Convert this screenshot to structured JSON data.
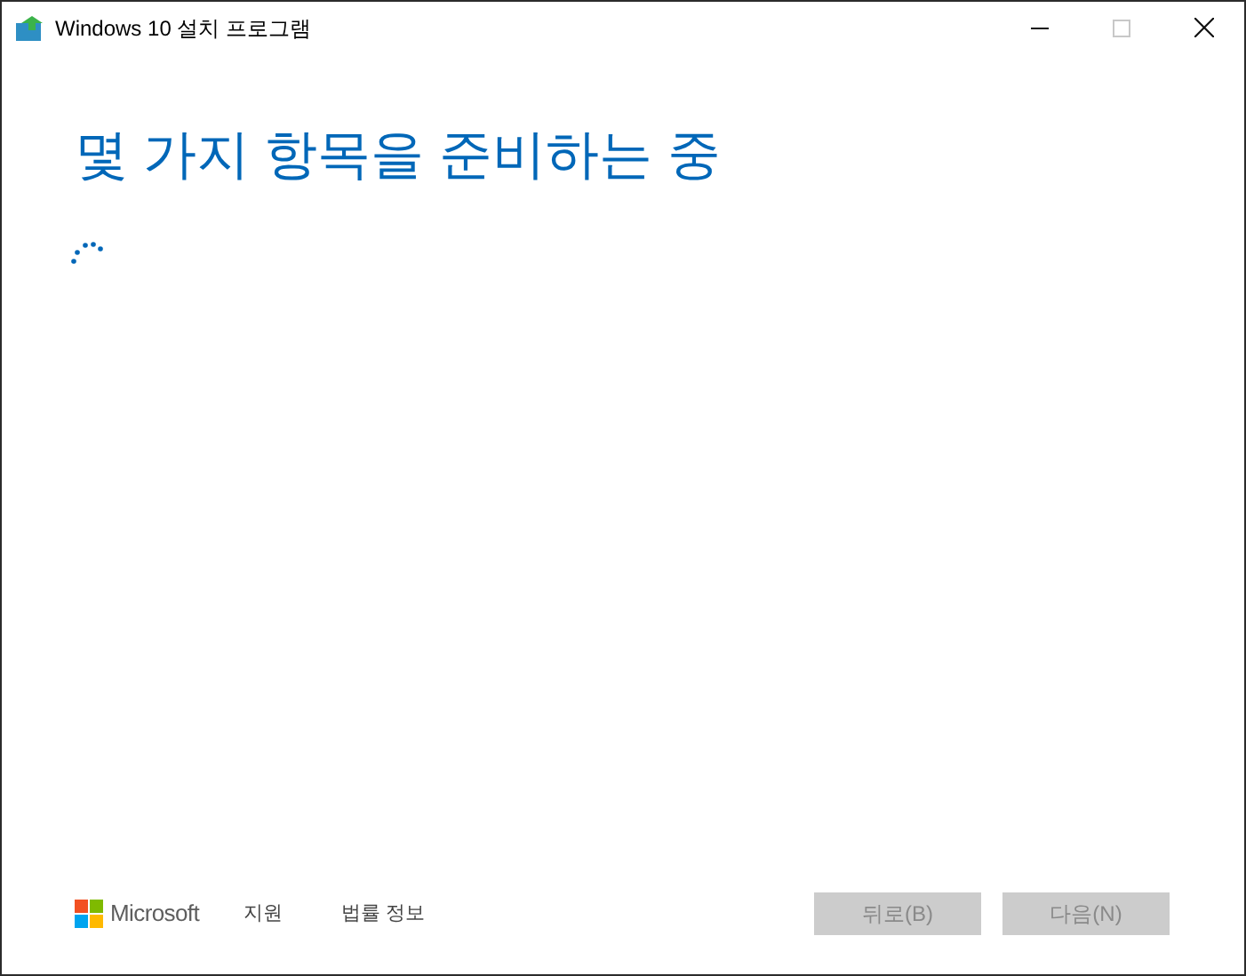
{
  "window": {
    "title": "Windows 10 설치 프로그램"
  },
  "heading": "몇 가지 항목을 준비하는 중",
  "footer": {
    "brand": "Microsoft",
    "links": [
      "지원",
      "법률 정보"
    ]
  },
  "buttons": [
    {
      "label": "뒤로(B)",
      "disabled": true
    },
    {
      "label": "다음(N)",
      "disabled": true
    }
  ]
}
